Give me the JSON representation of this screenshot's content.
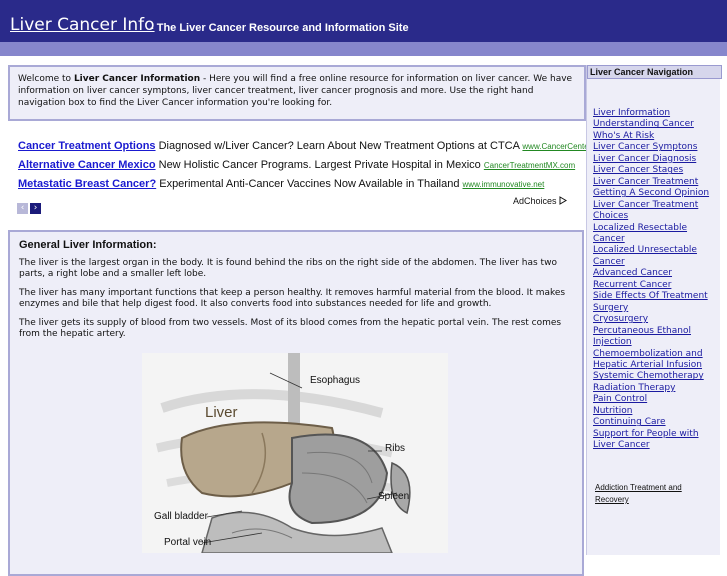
{
  "header": {
    "title": "Liver Cancer Info",
    "tagline": "- The Liver Cancer Resource and Information Site"
  },
  "welcome": {
    "intro": "Welcome to ",
    "bold": "Liver Cancer Information",
    "rest": " - Here you will find a free online resource for information on liver cancer. We have information on liver cancer symptons, liver cancer treatment, liver cancer prognosis and more. Use the right hand navigation box to find the Liver Cancer information you're looking for."
  },
  "ads": {
    "items": [
      {
        "title": "Cancer Treatment Options",
        "text": " Diagnosed w/Liver Cancer? Learn About New Treatment Options at CTCA ",
        "url": "www.CancerCenter.com"
      },
      {
        "title": "Alternative Cancer Mexico",
        "text": " New Holistic Cancer Programs. Largest Private Hospital in Mexico ",
        "url": "CancerTreatmentMX.com"
      },
      {
        "title": "Metastatic Breast Cancer?",
        "text": " Experimental Anti-Cancer Vaccines Now Available in Thailand ",
        "url": "www.immunovative.net"
      }
    ],
    "prev_icon": "chevron-left-icon",
    "next_icon": "chevron-right-icon",
    "adchoices": "AdChoices",
    "adchoices_icon": "adchoices-triangle-icon"
  },
  "general": {
    "heading": "General Liver Information:",
    "p1": "The liver is the largest organ in the body. It is found behind the ribs on the right side of the abdomen. The liver has two parts, a right lobe and a smaller left lobe.",
    "p2": "The liver has many important functions that keep a person healthy. It removes harmful material from the blood. It makes enzymes and bile that help digest food. It also converts food into substances needed for life and growth.",
    "p3": "The liver gets its supply of blood from two vessels. Most of its blood comes from the hepatic portal vein. The rest comes from the hepatic artery.",
    "diagram": {
      "liver": "Liver",
      "esophagus": "Esophagus",
      "ribs": "Ribs",
      "spleen": "Spleen",
      "gall_bladder": "Gall bladder",
      "portal_vein": "Portal vein"
    }
  },
  "nav": {
    "title": "Liver Cancer Navigation",
    "items": [
      "Liver Information",
      "Understanding Cancer",
      "Who's At Risk",
      "Liver Cancer Symptons",
      "Liver Cancer Diagnosis",
      "Liver Cancer Stages",
      "Liver Cancer Treatment",
      "Getting A Second Opinion",
      "Liver Cancer Treatment Choices",
      "Localized Resectable Cancer",
      "Localized Unresectable Cancer",
      "Advanced Cancer",
      "Recurrent Cancer",
      "Side Effects Of Treatment",
      "Surgery",
      "Cryosurgery",
      "Percutaneous Ethanol Injection",
      "Chemoembolization and Hepatic Arterial Infusion",
      "Systemic Chemotherapy",
      "Radiation Therapy",
      "Pain Control",
      "Nutrition",
      "Continuing Care",
      "Support for People with Liver Cancer"
    ],
    "extra": "Addiction Treatment and Recovery"
  },
  "colors": {
    "header_bg": "#2a2a8a",
    "stripe": "#8686cc",
    "panel_bg": "#eeeef8",
    "panel_border": "#a9a9d6",
    "link": "#1a1aa0"
  }
}
